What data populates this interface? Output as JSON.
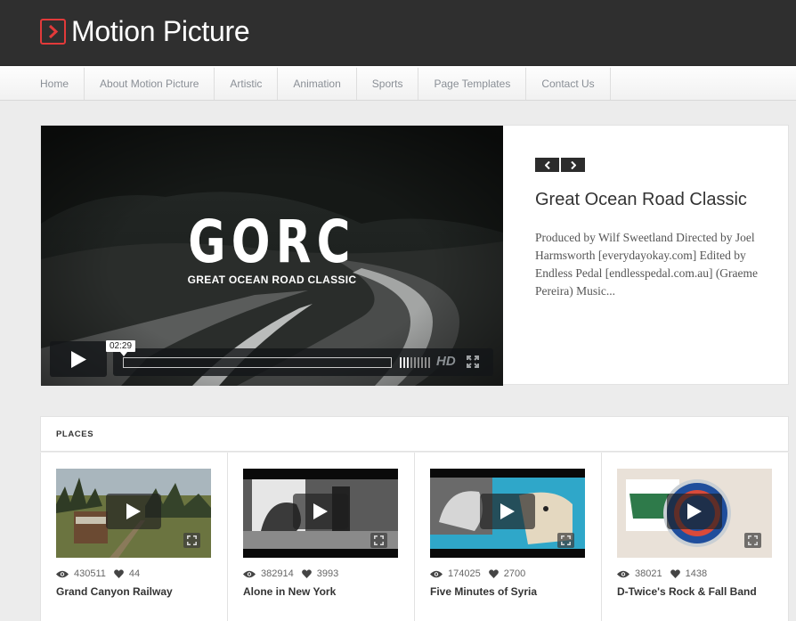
{
  "site": {
    "title": "Motion Picture"
  },
  "nav": [
    "Home",
    "About Motion Picture",
    "Artistic",
    "Animation",
    "Sports",
    "Page Templates",
    "Contact Us"
  ],
  "featured": {
    "video_title": "GORC",
    "video_subtitle": "GREAT OCEAN ROAD CLASSIC",
    "time": "02:29",
    "hd_label": "HD",
    "title": "Great Ocean Road Classic",
    "description": "Produced by Wilf Sweetland Directed by Joel Harmsworth [everydayokay.com] Edited by Endless Pedal [endlesspedal.com.au] (Graeme Pereira) Music..."
  },
  "section": {
    "title": "PLACES"
  },
  "videos": [
    {
      "views": "430511",
      "likes": "44",
      "title": "Grand Canyon Railway"
    },
    {
      "views": "382914",
      "likes": "3993",
      "title": "Alone in New York"
    },
    {
      "views": "174025",
      "likes": "2700",
      "title": "Five Minutes of Syria"
    },
    {
      "views": "38021",
      "likes": "1438",
      "title": "D-Twice's Rock & Fall Band"
    }
  ],
  "colors": {
    "header_bg": "#2f2f2f",
    "logo_accent": "#e23a3a",
    "nav_text": "#8a8f96",
    "page_bg": "#ececec"
  },
  "icons": {
    "logo": "play-arrow-box-icon",
    "views": "eye-icon",
    "likes": "heart-icon",
    "play": "play-icon",
    "fullscreen": "fullscreen-icon"
  }
}
